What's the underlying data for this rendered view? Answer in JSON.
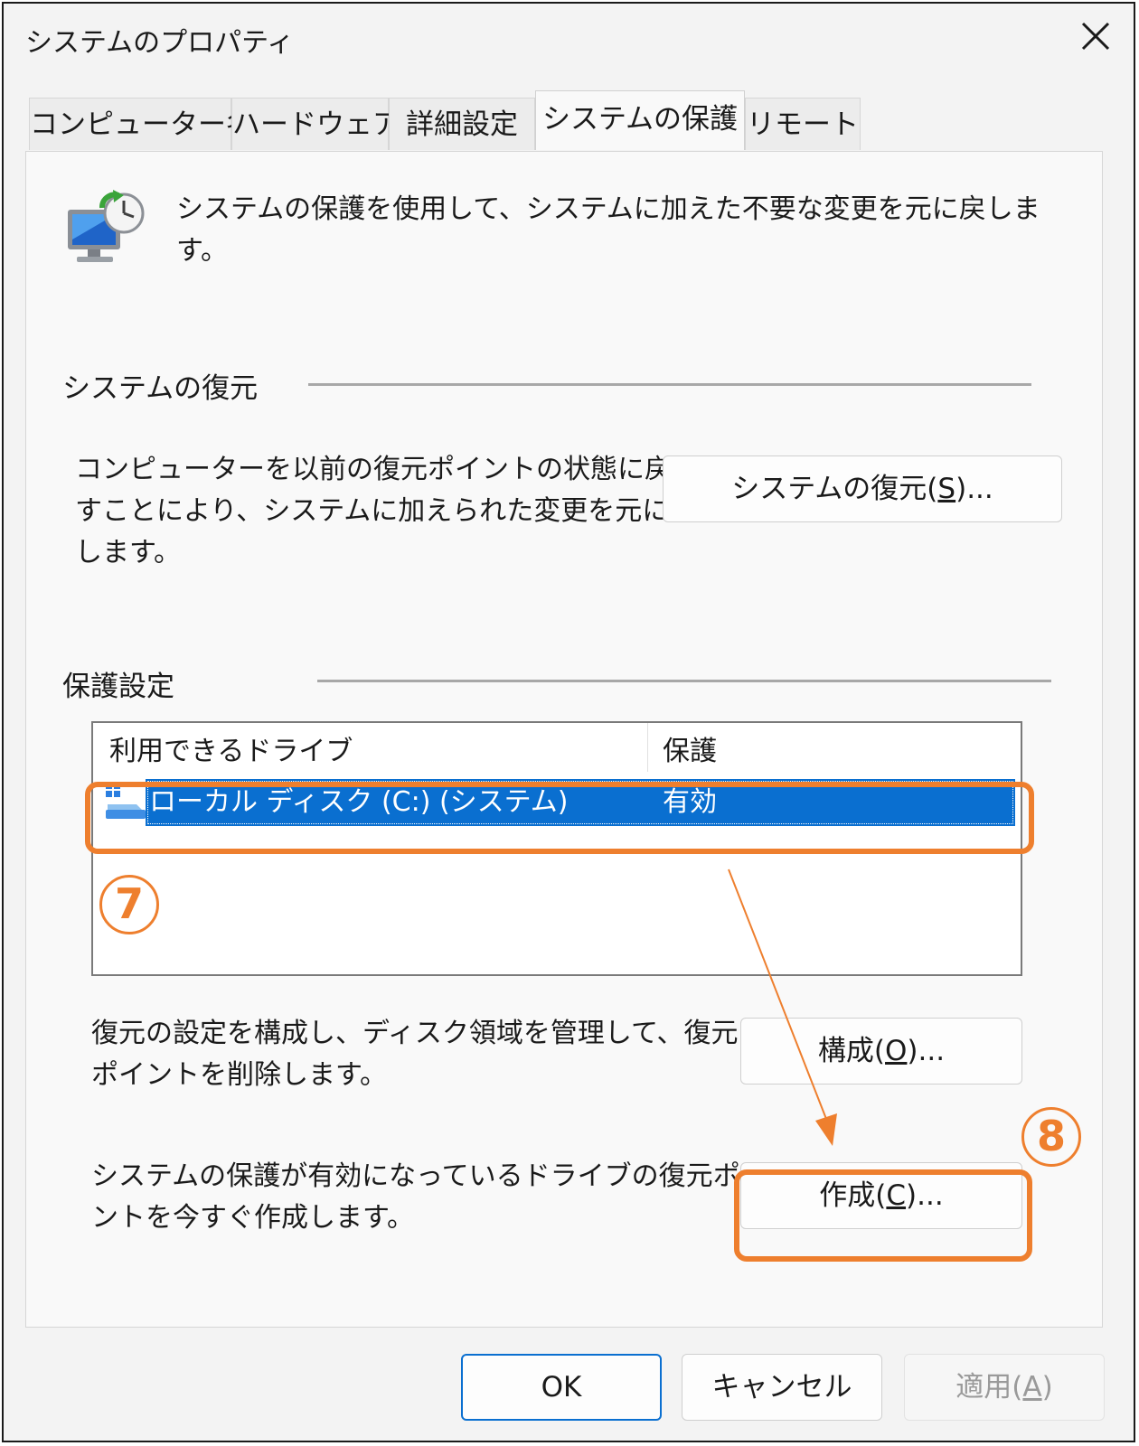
{
  "window": {
    "title": "システムのプロパティ"
  },
  "tabs": [
    {
      "label": "コンピューター名"
    },
    {
      "label": "ハードウェア"
    },
    {
      "label": "詳細設定"
    },
    {
      "label": "システムの保護",
      "active": true
    },
    {
      "label": "リモート"
    }
  ],
  "intro": {
    "line1": "システムの保護を使用して、システムに加えた不要な変更を元に戻しま",
    "line2": "す。"
  },
  "restore": {
    "heading": "システムの復元",
    "desc_line1": "コンピューターを以前の復元ポイントの状態に戻",
    "desc_line2": "すことにより、システムに加えられた変更を元に戻",
    "desc_line3": "します。",
    "button_prefix": "システムの復元(",
    "button_key": "S",
    "button_suffix": ")..."
  },
  "protection": {
    "heading": "保護設定",
    "columns": {
      "drive": "利用できるドライブ",
      "status": "保護"
    },
    "drives": [
      {
        "name": "ローカル ディスク (C:) (システム)",
        "status": "有効",
        "selected": true
      }
    ],
    "configure_desc_line1": "復元の設定を構成し、ディスク領域を管理して、復元",
    "configure_desc_line2": "ポイントを削除します。",
    "configure_prefix": "構成(",
    "configure_key": "O",
    "configure_suffix": ")...",
    "create_desc_line1": "システムの保護が有効になっているドライブの復元ポイ",
    "create_desc_line2": "ントを今すぐ作成します。",
    "create_prefix": "作成(",
    "create_key": "C",
    "create_suffix": ")..."
  },
  "footer": {
    "ok": "OK",
    "cancel": "キャンセル",
    "apply_prefix": "適用(",
    "apply_key": "A",
    "apply_suffix": ")"
  },
  "annotations": {
    "step7": "7",
    "step8": "8",
    "color": "#ee7f2e"
  },
  "colors": {
    "selection": "#0a6fd0",
    "window_bg": "#f3f3f3",
    "panel_bg": "#f9f9f9",
    "focus_border": "#0a6fd0"
  }
}
